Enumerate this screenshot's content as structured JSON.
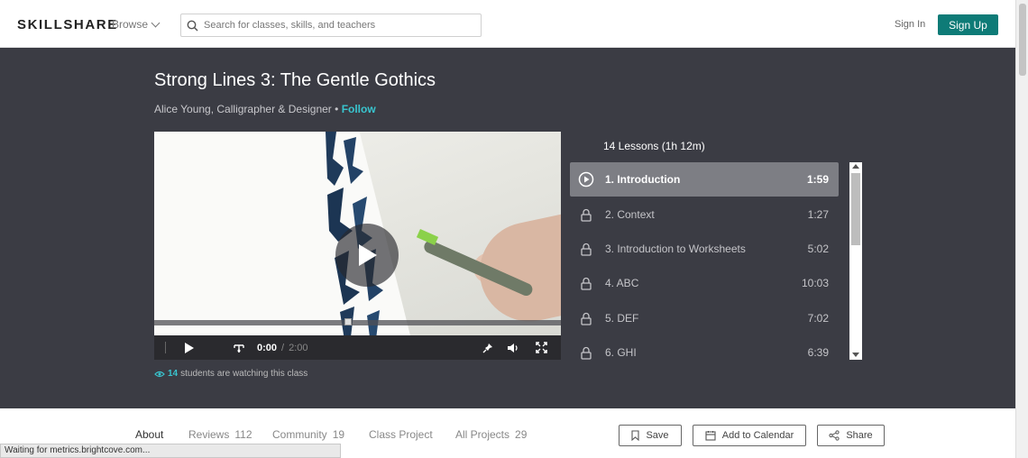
{
  "header": {
    "logo": "SKILLSHARE",
    "browse_label": "Browse",
    "search_placeholder": "Search for classes, skills, and teachers",
    "sign_in": "Sign In",
    "sign_up": "Sign Up"
  },
  "course": {
    "title": "Strong Lines 3: The Gentle Gothics",
    "teacher": "Alice Young, Calligrapher & Designer",
    "bullet": "•",
    "follow": "Follow"
  },
  "player": {
    "current_time": "0:00",
    "separator": "/",
    "duration": "2:00"
  },
  "watching": {
    "count": "14",
    "text": "students are watching this class"
  },
  "lessons": {
    "header": "14 Lessons (1h 12m)",
    "items": [
      {
        "title": "1. Introduction",
        "duration": "1:59",
        "active": true
      },
      {
        "title": "2. Context",
        "duration": "1:27",
        "active": false
      },
      {
        "title": "3. Introduction to Worksheets",
        "duration": "5:02",
        "active": false
      },
      {
        "title": "4. ABC",
        "duration": "10:03",
        "active": false
      },
      {
        "title": "5. DEF",
        "duration": "7:02",
        "active": false
      },
      {
        "title": "6. GHI",
        "duration": "6:39",
        "active": false
      }
    ]
  },
  "tabs": [
    {
      "label": "About",
      "count": ""
    },
    {
      "label": "Reviews",
      "count": "112"
    },
    {
      "label": "Community",
      "count": "19"
    },
    {
      "label": "Class Project",
      "count": ""
    },
    {
      "label": "All Projects",
      "count": "29"
    }
  ],
  "actions": {
    "save": "Save",
    "add_to_calendar": "Add to Calendar",
    "share": "Share"
  },
  "status_bar": "Waiting for metrics.brightcove.com...",
  "colors": {
    "accent": "#39c5cf",
    "signup_bg": "#0e7b77",
    "hero_bg": "#3b3c44"
  }
}
